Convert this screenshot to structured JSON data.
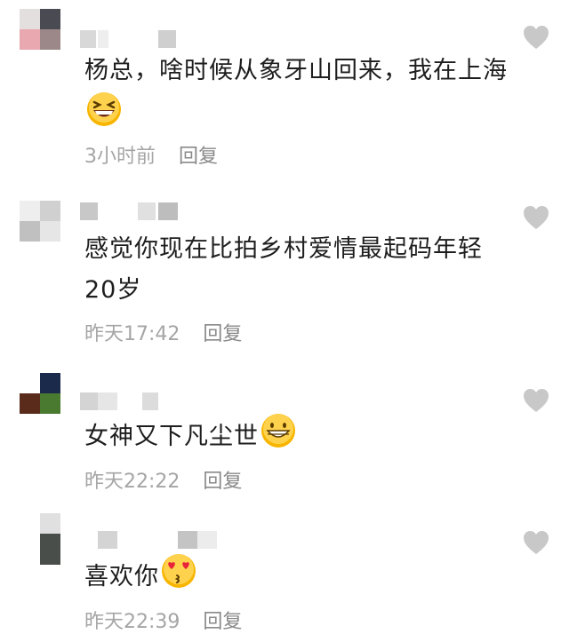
{
  "comments": [
    {
      "text": "杨总，啥时候从象牙山回来，我在上海",
      "emoji": "grinning-squint-face",
      "time": "3小时前",
      "reply": "回复"
    },
    {
      "text": "感觉你现在比拍乡村爱情最起码年轻20岁",
      "emoji": "",
      "time": "昨天17:42",
      "reply": "回复"
    },
    {
      "text": "女神又下凡尘世",
      "emoji": "grinning-face",
      "time": "昨天22:22",
      "reply": "回复"
    },
    {
      "text": "喜欢你",
      "emoji": "kissing-heart-eyes-face",
      "time": "昨天22:39",
      "reply": "回复"
    }
  ],
  "icons": {
    "like": "heart-icon"
  },
  "colors": {
    "text": "#1e1e1e",
    "meta": "#a5a5a5",
    "heart": "#c8c8c8"
  }
}
